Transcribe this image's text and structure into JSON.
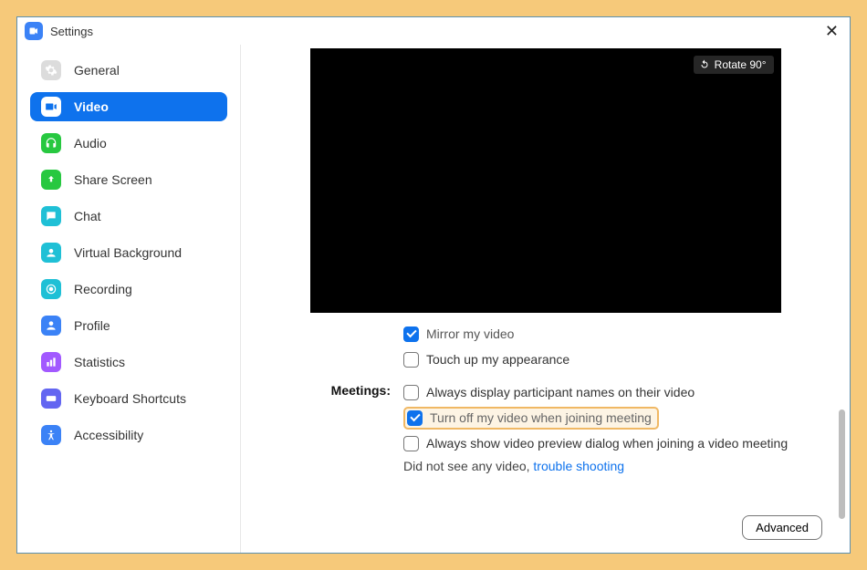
{
  "window": {
    "title": "Settings"
  },
  "sidebar": {
    "items": [
      {
        "label": "General"
      },
      {
        "label": "Video"
      },
      {
        "label": "Audio"
      },
      {
        "label": "Share Screen"
      },
      {
        "label": "Chat"
      },
      {
        "label": "Virtual Background"
      },
      {
        "label": "Recording"
      },
      {
        "label": "Profile"
      },
      {
        "label": "Statistics"
      },
      {
        "label": "Keyboard Shortcuts"
      },
      {
        "label": "Accessibility"
      }
    ]
  },
  "preview": {
    "rotate_label": "Rotate 90°"
  },
  "video_opts": {
    "mirror": "Mirror my video",
    "touchup": "Touch up my appearance"
  },
  "meetings": {
    "section_label": "Meetings:",
    "opt_names": "Always display participant names on their video",
    "opt_turnoff": "Turn off my video when joining meeting",
    "opt_preview": "Always show video preview dialog when joining a video meeting",
    "hint_prefix": "Did not see any video,  ",
    "hint_link": "trouble shooting"
  },
  "footer": {
    "advanced": "Advanced"
  }
}
